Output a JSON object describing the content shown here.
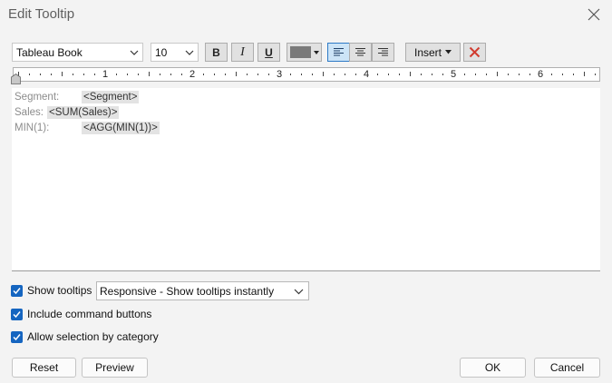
{
  "dialog": {
    "title": "Edit Tooltip"
  },
  "toolbar": {
    "font_family": "Tableau Book",
    "font_size": "10",
    "bold_label": "B",
    "italic_label": "I",
    "underline_label": "U",
    "text_color": "#7a7a7a",
    "insert_label": "Insert",
    "align_selected": "left"
  },
  "ruler": {
    "labels": [
      "1",
      "2",
      "3",
      "4",
      "5",
      "6"
    ]
  },
  "editor": {
    "lines": [
      {
        "label": "Segment:",
        "field": "<Segment>"
      },
      {
        "label": "Sales:",
        "field": "<SUM(Sales)>"
      },
      {
        "label": "MIN(1):",
        "field": "<AGG(MIN(1))>"
      }
    ]
  },
  "options": {
    "show_tooltips": {
      "label": "Show tooltips",
      "checked": true
    },
    "tooltip_mode": "Responsive - Show tooltips instantly",
    "include_command_buttons": {
      "label": "Include command buttons",
      "checked": true
    },
    "allow_selection_by_category": {
      "label": "Allow selection by category",
      "checked": true
    }
  },
  "buttons": {
    "reset": "Reset",
    "preview": "Preview",
    "ok": "OK",
    "cancel": "Cancel"
  },
  "colors": {
    "accent": "#1565c0",
    "clear_icon": "#d13b2f"
  }
}
